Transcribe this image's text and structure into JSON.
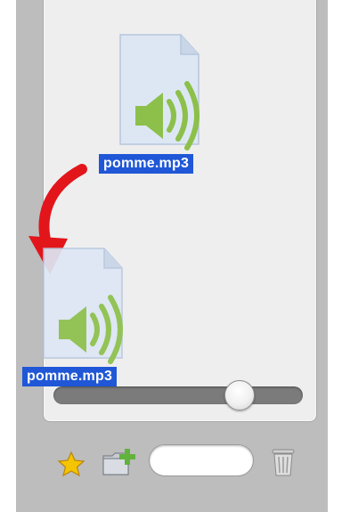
{
  "files": [
    {
      "name": "pomme.mp3",
      "state": "original"
    },
    {
      "name": "pomme.mp3",
      "state": "dragging"
    }
  ],
  "search": {
    "value": ""
  },
  "icons": {
    "file_icon": "audio-file-icon",
    "drag_arrow": "red-curved-arrow",
    "favorite": "star-icon",
    "new_folder": "new-folder-icon",
    "trash": "trash-icon"
  },
  "colors": {
    "selection": "#1f57d6",
    "arrow": "#e2151b",
    "speaker": "#8cc04b",
    "star": "#f5c400"
  }
}
